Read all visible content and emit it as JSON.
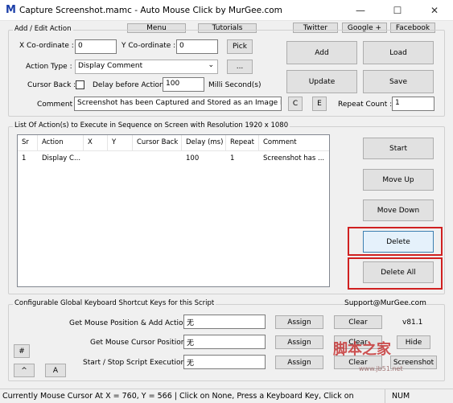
{
  "window": {
    "icon_letter": "M",
    "title": "Capture Screenshot.mamc - Auto Mouse Click by MurGee.com",
    "minimize": "—",
    "maximize": "☐",
    "close": "✕"
  },
  "top_links": {
    "menu": "Menu",
    "tutorials": "Tutorials",
    "twitter": "Twitter",
    "google": "Google +",
    "facebook": "Facebook"
  },
  "edit": {
    "legend": "Add / Edit Action",
    "x_label": "X Co-ordinate :",
    "x_value": "0",
    "y_label": "Y Co-ordinate :",
    "y_value": "0",
    "pick": "Pick",
    "action_type_label": "Action Type :",
    "action_type_value": "Display Comment",
    "ellipsis": "...",
    "cursor_back_label": "Cursor Back :",
    "delay_label": "Delay before Action :",
    "delay_value": "100",
    "delay_unit": "Milli Second(s)",
    "comment_label": "Comment :",
    "comment_value": "Screenshot has been Captured and Stored as an Image File. Cli",
    "c_button": "C",
    "e_button": "E",
    "repeat_label": "Repeat Count :",
    "repeat_value": "1",
    "add": "Add",
    "load": "Load",
    "update": "Update",
    "save": "Save"
  },
  "list": {
    "legend": "List Of Action(s) to Execute in Sequence on Screen with Resolution 1920 x 1080",
    "columns": [
      "Sr",
      "Action",
      "X",
      "Y",
      "Cursor Back",
      "Delay (ms)",
      "Repeat",
      "Comment"
    ],
    "rows": [
      [
        "1",
        "Display C...",
        "",
        "",
        "",
        "100",
        "1",
        "Screenshot has ..."
      ]
    ]
  },
  "side_buttons": {
    "start": "Start",
    "move_up": "Move Up",
    "move_down": "Move Down",
    "delete": "Delete",
    "delete_all": "Delete All"
  },
  "shortcuts": {
    "legend": "Configurable Global Keyboard Shortcut Keys for this Script",
    "support": "Support@MurGee.com",
    "version": "v81.1",
    "rows": [
      {
        "label": "Get Mouse Position & Add Action :",
        "value": "无",
        "assign": "Assign",
        "clear": "Clear"
      },
      {
        "label": "Get Mouse Cursor Position :",
        "value": "无",
        "assign": "Assign",
        "clear": "Clear"
      },
      {
        "label": "Start / Stop Script Execution :",
        "value": "无",
        "assign": "Assign",
        "clear": "Clear"
      }
    ],
    "hide": "Hide",
    "screenshot": "Screenshot",
    "hash": "#",
    "caret": "^",
    "a": "A"
  },
  "watermark": {
    "cn": "脚本之家",
    "url": "www.jb51.net"
  },
  "status": {
    "text": "Currently Mouse Cursor At X = 760, Y = 566 | Click on None, Press a Keyboard Key, Click on",
    "num": "NUM"
  },
  "colors": {
    "accent_red": "#d02020",
    "focus_blue": "#3c7fb1",
    "logo_blue": "#1b3ea8"
  }
}
